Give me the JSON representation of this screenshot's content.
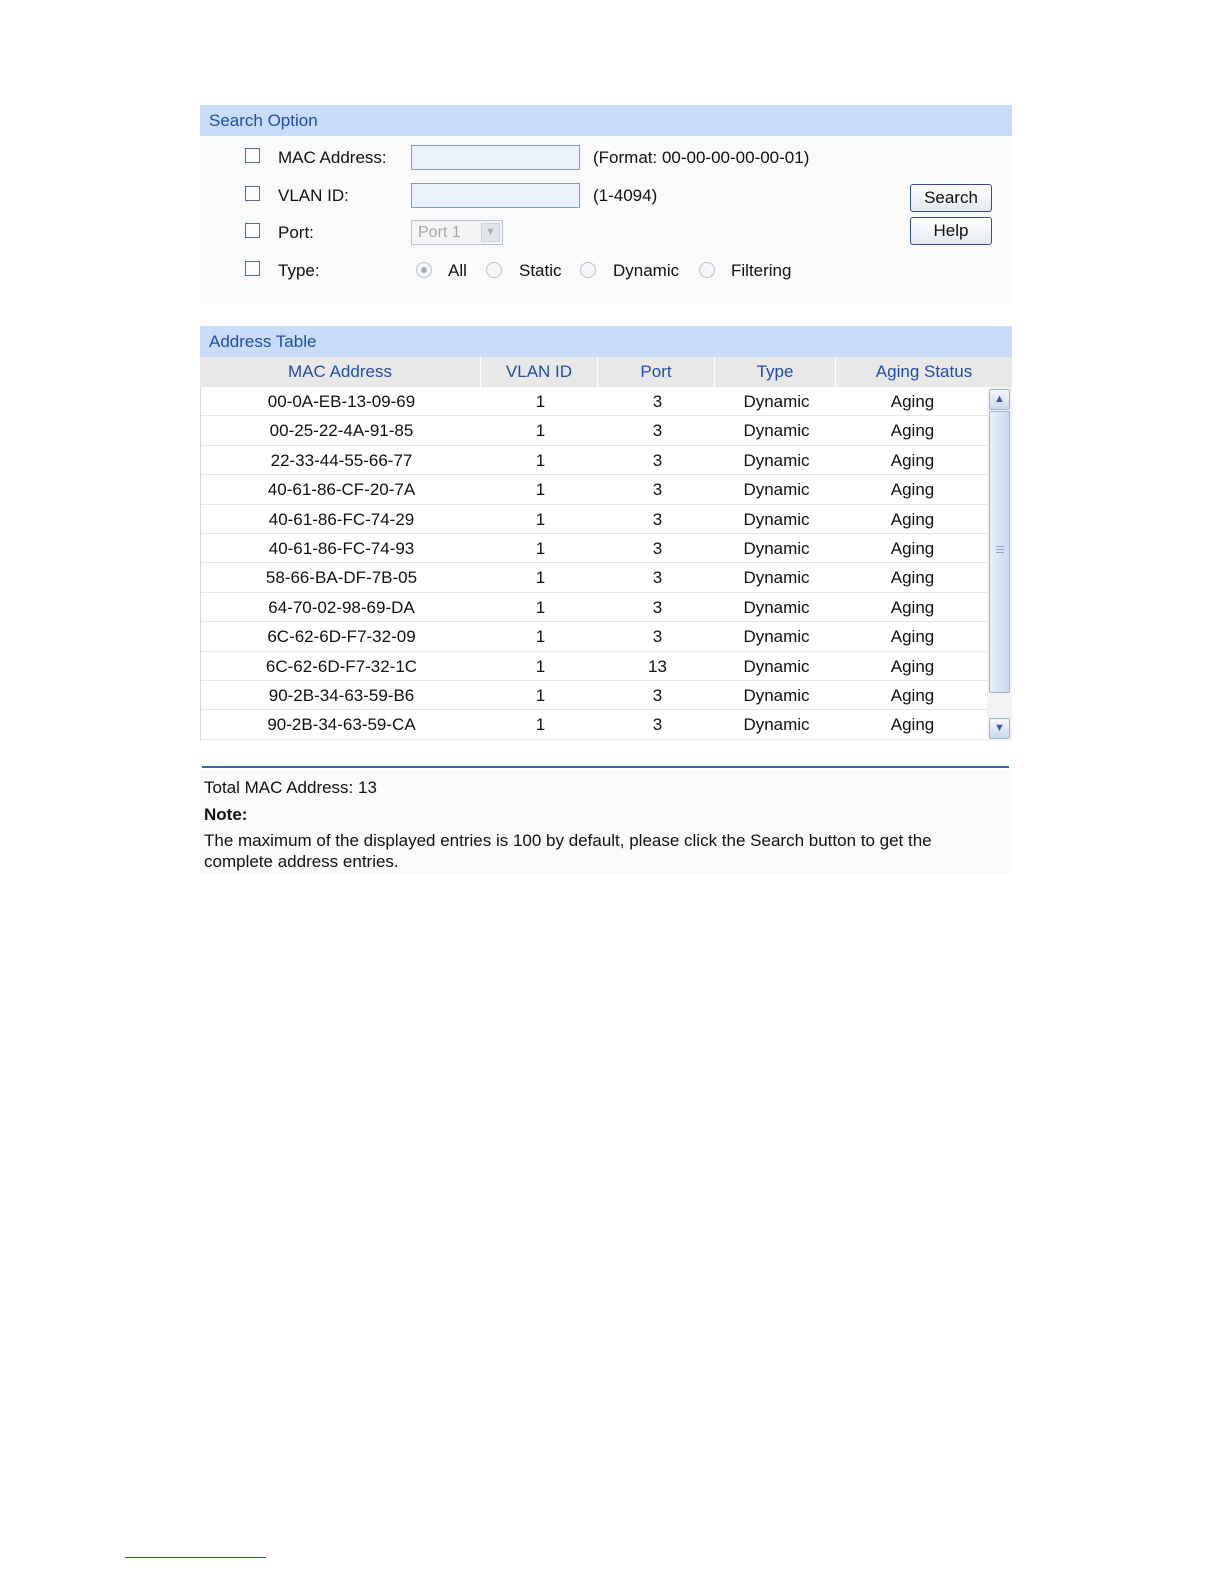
{
  "search": {
    "title": "Search Option",
    "mac_label": "MAC Address:",
    "mac_value": "",
    "mac_hint": "(Format: 00-00-00-00-00-01)",
    "vlan_label": "VLAN ID:",
    "vlan_value": "",
    "vlan_hint": "(1-4094)",
    "port_label": "Port:",
    "port_selected": "Port 1",
    "type_label": "Type:",
    "type_options": [
      "All",
      "Static",
      "Dynamic",
      "Filtering"
    ],
    "type_selected": "All",
    "search_button": "Search",
    "help_button": "Help"
  },
  "table": {
    "title": "Address Table",
    "columns": [
      "MAC Address",
      "VLAN ID",
      "Port",
      "Type",
      "Aging Status"
    ],
    "rows": [
      [
        "00-0A-EB-13-09-69",
        "1",
        "3",
        "Dynamic",
        "Aging"
      ],
      [
        "00-25-22-4A-91-85",
        "1",
        "3",
        "Dynamic",
        "Aging"
      ],
      [
        "22-33-44-55-66-77",
        "1",
        "3",
        "Dynamic",
        "Aging"
      ],
      [
        "40-61-86-CF-20-7A",
        "1",
        "3",
        "Dynamic",
        "Aging"
      ],
      [
        "40-61-86-FC-74-29",
        "1",
        "3",
        "Dynamic",
        "Aging"
      ],
      [
        "40-61-86-FC-74-93",
        "1",
        "3",
        "Dynamic",
        "Aging"
      ],
      [
        "58-66-BA-DF-7B-05",
        "1",
        "3",
        "Dynamic",
        "Aging"
      ],
      [
        "64-70-02-98-69-DA",
        "1",
        "3",
        "Dynamic",
        "Aging"
      ],
      [
        "6C-62-6D-F7-32-09",
        "1",
        "3",
        "Dynamic",
        "Aging"
      ],
      [
        "6C-62-6D-F7-32-1C",
        "1",
        "13",
        "Dynamic",
        "Aging"
      ],
      [
        "90-2B-34-63-59-B6",
        "1",
        "3",
        "Dynamic",
        "Aging"
      ],
      [
        "90-2B-34-63-59-CA",
        "1",
        "3",
        "Dynamic",
        "Aging"
      ]
    ]
  },
  "footer": {
    "total": "Total MAC Address: 13",
    "note_title": "Note:",
    "note_line1": "The maximum of the displayed entries is 100 by default, please click the Search button to get the",
    "note_line2": "complete address entries."
  },
  "icons": {
    "scroll_up": "chevron-up-icon",
    "scroll_down": "chevron-down-icon",
    "dropdown": "chevron-down-icon"
  },
  "colors": {
    "header_bg": "#c9dcf9",
    "header_text": "#1f4ea8",
    "rule": "#2e6aa8"
  }
}
